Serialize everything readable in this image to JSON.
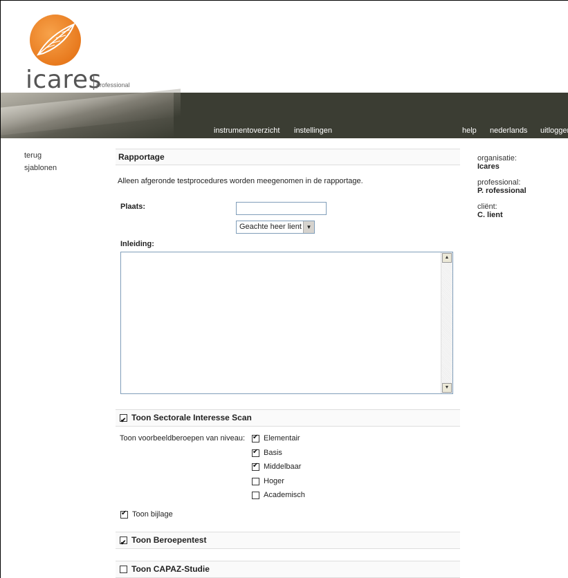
{
  "brand": {
    "wordmark": "icares",
    "subtitle": "professional"
  },
  "nav": {
    "instrumentoverzicht": "instrumentoverzicht",
    "instellingen": "instellingen",
    "help": "help",
    "nederlands": "nederlands",
    "uitloggen": "uitloggen"
  },
  "sidebar": {
    "items": [
      {
        "label": "terug"
      },
      {
        "label": "sjablonen"
      }
    ]
  },
  "info": {
    "organisatie_label": "organisatie:",
    "organisatie_value": "Icares",
    "professional_label": "professional:",
    "professional_value": "P. rofessional",
    "client_label": "cliënt:",
    "client_value": "C. lient"
  },
  "report": {
    "title": "Rapportage",
    "intro": "Alleen afgeronde testprocedures worden meegenomen in de rapportage.",
    "plaats_label": "Plaats:",
    "plaats_value": "",
    "salutation_value": "Geachte heer lient",
    "inleiding_label": "Inleiding:",
    "inleiding_value": ""
  },
  "sections": {
    "sis": {
      "label": "Toon Sectorale Interesse Scan",
      "checked": true
    },
    "niveau_label": "Toon voorbeeldberoepen van niveau:",
    "niveaus": [
      {
        "label": "Elementair",
        "checked": true
      },
      {
        "label": "Basis",
        "checked": true
      },
      {
        "label": "Middelbaar",
        "checked": true
      },
      {
        "label": "Hoger",
        "checked": false
      },
      {
        "label": "Academisch",
        "checked": false
      }
    ],
    "bijlage": {
      "label": "Toon bijlage",
      "checked": true
    },
    "beroepentest": {
      "label": "Toon Beroepentest",
      "checked": true
    },
    "capaz": {
      "label": "Toon CAPAZ-Studie",
      "checked": false
    }
  },
  "colors": {
    "banner": "#3b3d33",
    "logo_orange": "#e87a1e"
  }
}
